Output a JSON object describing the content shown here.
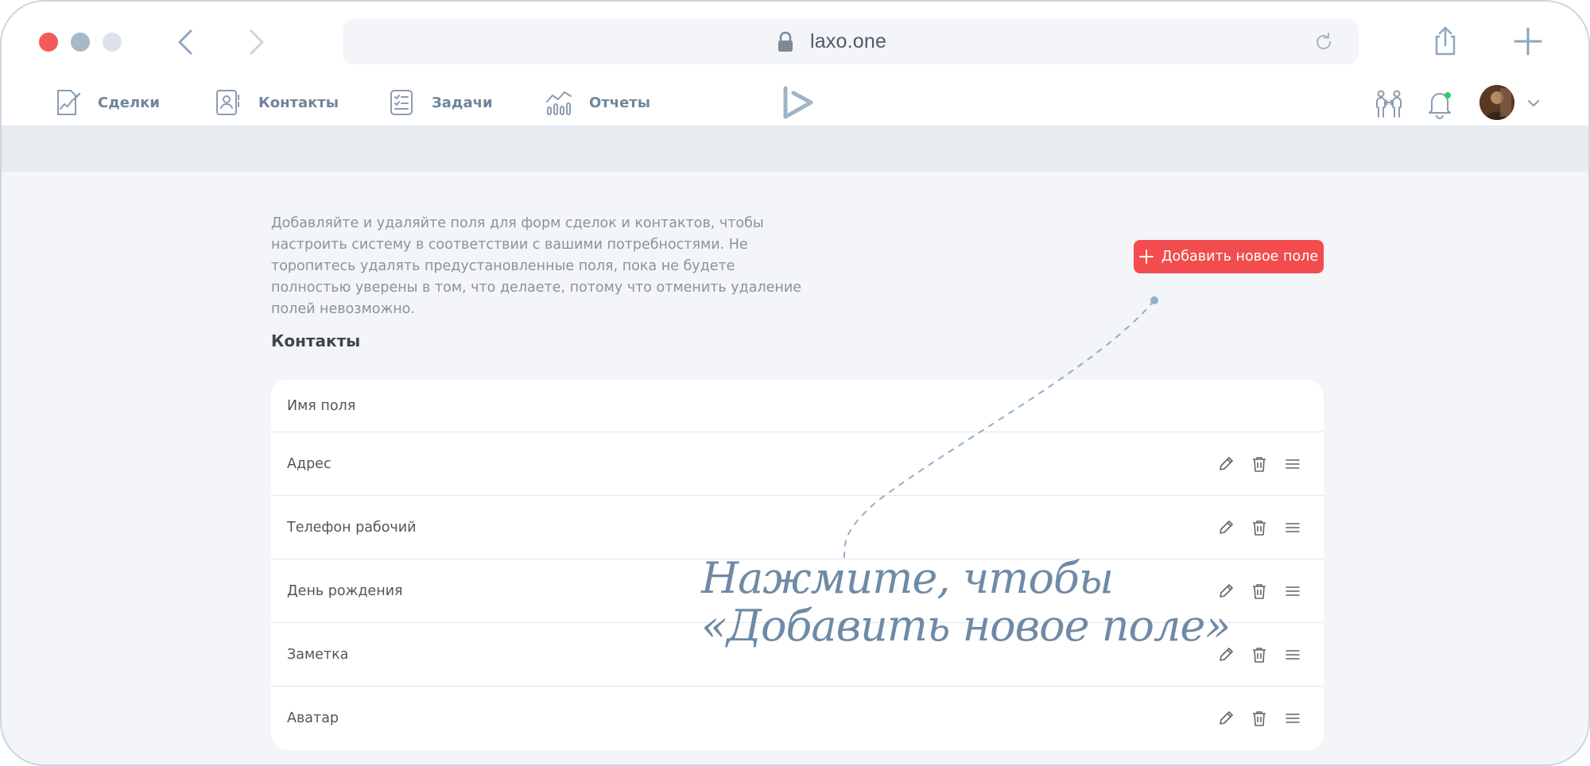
{
  "browser": {
    "url": "laxo.one"
  },
  "nav": {
    "items": [
      {
        "label": "Сделки",
        "icon": "deals-icon"
      },
      {
        "label": "Контакты",
        "icon": "contacts-icon"
      },
      {
        "label": "Задачи",
        "icon": "tasks-icon"
      },
      {
        "label": "Отчеты",
        "icon": "reports-icon"
      }
    ],
    "notification_dot_color": "#2ecc71"
  },
  "page": {
    "description": "Добавляйте и удаляйте поля для форм сделок и контактов, чтобы настроить систему в соответствии с вашими потребностями. Не торопитесь удалять предустановленные поля, пока не будете полностью уверены в том, что делаете, потому что отменить удаление полей невозможно.",
    "add_button_label": "Добавить новое поле",
    "section_title": "Контакты",
    "table_header": "Имя поля",
    "fields": [
      {
        "name": "Адрес"
      },
      {
        "name": "Телефон рабочий"
      },
      {
        "name": "День рождения"
      },
      {
        "name": "Заметка"
      },
      {
        "name": "Аватар"
      }
    ]
  },
  "hint": {
    "line1": "Нажмите, чтобы",
    "line2": "«Добавить новое поле»"
  },
  "colors": {
    "accent": "#f24c4e",
    "nav_text": "#70859b",
    "hint": "#6e8aa6"
  }
}
